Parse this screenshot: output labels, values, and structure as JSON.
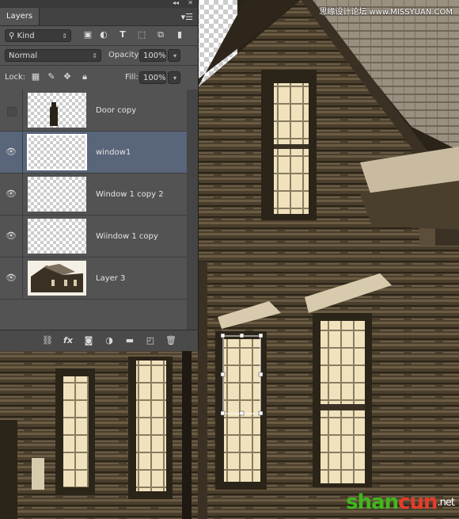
{
  "panel": {
    "tab_label": "Layers",
    "collapse_icon": "double-chevron-left",
    "close_icon": "close-x",
    "menu_icon": "hamburger-menu",
    "filter": {
      "kind_label": "Kind",
      "filter_icons": [
        "image-filter-icon",
        "adjustment-filter-icon",
        "type-filter-icon",
        "shape-filter-icon",
        "smart-object-filter-icon",
        "filter-toggle-icon"
      ]
    },
    "blend_mode": "Normal",
    "opacity_label": "Opacity:",
    "opacity_value": "100%",
    "lock_label": "Lock:",
    "fill_label": "Fill:",
    "fill_value": "100%",
    "layers": [
      {
        "name": "Door copy",
        "visible": false,
        "selected": false,
        "thumb": "door"
      },
      {
        "name": "window1",
        "visible": true,
        "selected": true,
        "thumb": "empty"
      },
      {
        "name": "Window 1 copy 2",
        "visible": true,
        "selected": false,
        "thumb": "empty"
      },
      {
        "name": "Wiindow 1 copy",
        "visible": true,
        "selected": false,
        "thumb": "empty"
      },
      {
        "name": "Layer 3",
        "visible": true,
        "selected": false,
        "thumb": "house"
      }
    ],
    "bottom_icons": [
      "link-layers-icon",
      "fx-icon",
      "add-mask-icon",
      "adjustment-layer-icon",
      "new-group-icon",
      "new-layer-icon",
      "delete-layer-icon"
    ],
    "fx_label": "fx"
  },
  "watermark_top": "思缘设计论坛 www.MISSYUAN.COM",
  "watermark_bottom": {
    "part1": "shan",
    "part2": "cun",
    "part3": ".net"
  },
  "colors": {
    "panel_bg": "#535353",
    "selected_row": "#59657a",
    "sepia_dark": "#2a2318",
    "sepia_light": "#e8dcb8"
  }
}
